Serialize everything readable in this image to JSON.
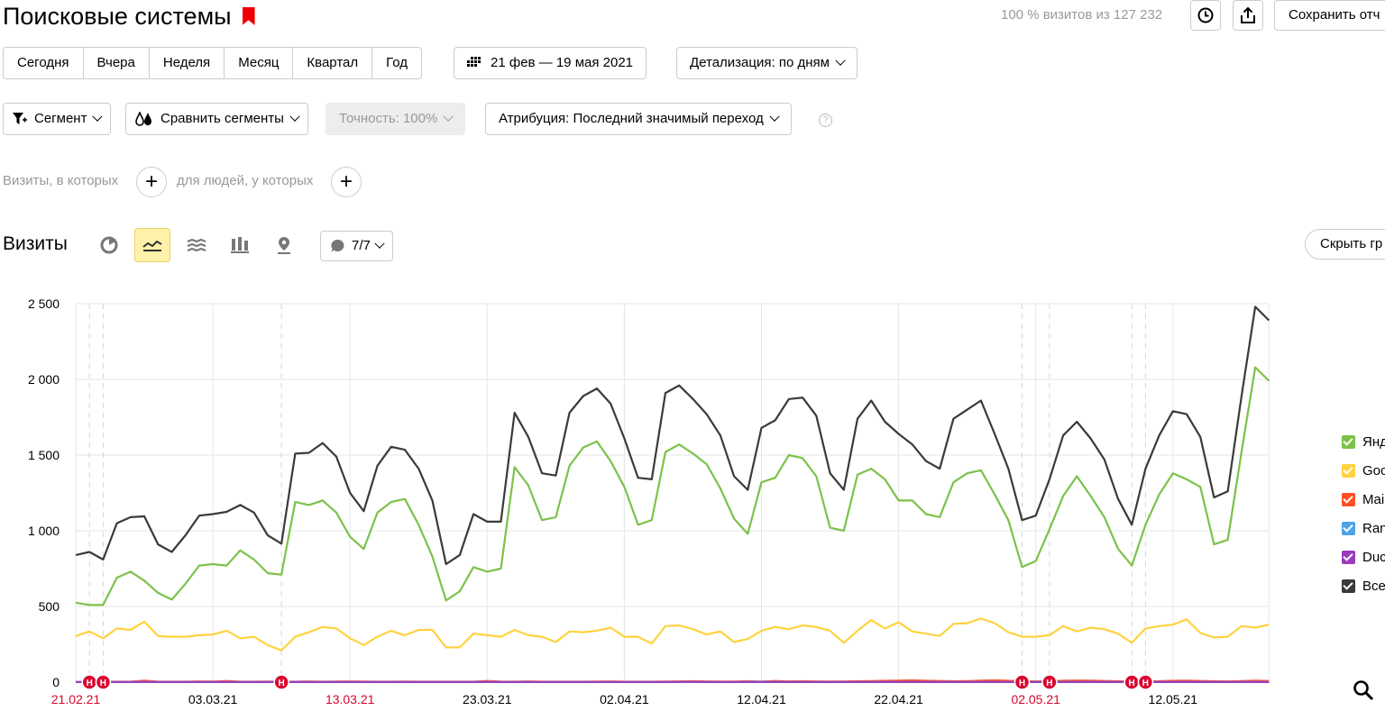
{
  "header": {
    "title": "Поисковые системы",
    "visits_summary": "100 % визитов из 127 232",
    "save_label": "Сохранить отч"
  },
  "periods": [
    "Сегодня",
    "Вчера",
    "Неделя",
    "Месяц",
    "Квартал",
    "Год"
  ],
  "date_range": "21 фев — 19 мая 2021",
  "detail": "Детализация: по дням",
  "toolbar": {
    "segment": "Сегмент",
    "compare": "Сравнить сегменты",
    "accuracy": "Точность: 100%",
    "attribution": "Атрибуция: Последний значимый переход",
    "help": "?"
  },
  "filters": {
    "visits_label": "Визиты, в которых",
    "people_label": "для людей, у которых",
    "plus": "+"
  },
  "section": {
    "title": "Визиты",
    "notes": "7/7",
    "hide_label": "Скрыть гр"
  },
  "icons": [
    "pie-chart-icon",
    "line-chart-icon",
    "area-chart-icon",
    "bar-chart-icon",
    "map-icon",
    "comment-icon",
    "clock-icon",
    "share-icon",
    "calendar-icon",
    "filter-icon",
    "compare-icon",
    "search-icon"
  ],
  "colors": {
    "yandex": "#7cc24a",
    "google": "#ffd23f",
    "mail": "#ff4f24",
    "rambler": "#4ea4e8",
    "duckduckgo": "#9b3bbd",
    "total": "#3a3a3a",
    "holiday": "#d9062f",
    "active_bg": "#fff2a8"
  },
  "chart_data": {
    "type": "line",
    "ylim": [
      0,
      2500
    ],
    "yticks": [
      "2 500",
      "2 000",
      "1 500",
      "1 000",
      "500",
      "0"
    ],
    "ytick_values": [
      2500,
      2000,
      1500,
      1000,
      500,
      0
    ],
    "x_start": "21.02.21",
    "days": 88,
    "xtick_labels": [
      {
        "day": 0,
        "label": "21.02.21",
        "holiday": true
      },
      {
        "day": 10,
        "label": "03.03.21",
        "holiday": false
      },
      {
        "day": 20,
        "label": "13.03.21",
        "holiday": true
      },
      {
        "day": 30,
        "label": "23.03.21",
        "holiday": false
      },
      {
        "day": 40,
        "label": "02.04.21",
        "holiday": false
      },
      {
        "day": 50,
        "label": "12.04.21",
        "holiday": false
      },
      {
        "day": 60,
        "label": "22.04.21",
        "holiday": false
      },
      {
        "day": 70,
        "label": "02.05.21",
        "holiday": true
      },
      {
        "day": 80,
        "label": "12.05.21",
        "holiday": false
      }
    ],
    "holiday_markers": [
      {
        "day": 1,
        "label": "Н"
      },
      {
        "day": 2,
        "label": "Н"
      },
      {
        "day": 15,
        "label": "Н"
      },
      {
        "day": 69,
        "label": "Н"
      },
      {
        "day": 71,
        "label": "Н"
      },
      {
        "day": 77,
        "label": "Н"
      },
      {
        "day": 78,
        "label": "Н"
      }
    ],
    "series": [
      {
        "name": "Яндекс",
        "legend_label": "Янд",
        "color": "#7cc24a",
        "values": [
          525,
          510,
          510,
          690,
          730,
          670,
          590,
          545,
          650,
          770,
          780,
          770,
          870,
          810,
          720,
          710,
          1190,
          1170,
          1200,
          1120,
          960,
          880,
          1120,
          1190,
          1210,
          1040,
          830,
          540,
          600,
          760,
          730,
          750,
          1420,
          1300,
          1070,
          1090,
          1430,
          1550,
          1590,
          1460,
          1290,
          1040,
          1070,
          1520,
          1570,
          1510,
          1440,
          1280,
          1080,
          980,
          1320,
          1350,
          1500,
          1480,
          1360,
          1020,
          1000,
          1370,
          1410,
          1340,
          1200,
          1200,
          1110,
          1090,
          1320,
          1380,
          1400,
          1240,
          1070,
          760,
          800,
          1010,
          1230,
          1360,
          1230,
          1090,
          880,
          770,
          1040,
          1240,
          1380,
          1340,
          1290,
          910,
          940,
          1520,
          2080,
          1990
        ]
      },
      {
        "name": "Google",
        "legend_label": "Goo",
        "color": "#ffd23f",
        "values": [
          305,
          335,
          290,
          355,
          345,
          400,
          305,
          300,
          300,
          310,
          315,
          340,
          290,
          300,
          245,
          210,
          300,
          330,
          365,
          355,
          290,
          245,
          300,
          340,
          310,
          345,
          345,
          230,
          230,
          320,
          310,
          300,
          345,
          310,
          300,
          265,
          335,
          330,
          340,
          360,
          300,
          300,
          255,
          370,
          375,
          350,
          315,
          335,
          265,
          285,
          340,
          365,
          350,
          375,
          365,
          340,
          260,
          340,
          410,
          355,
          395,
          335,
          320,
          305,
          385,
          390,
          420,
          390,
          330,
          300,
          300,
          310,
          370,
          335,
          360,
          350,
          320,
          260,
          355,
          370,
          380,
          415,
          325,
          295,
          300,
          370,
          360,
          380
        ]
      },
      {
        "name": "Mail.ru",
        "legend_label": "Mai",
        "color": "#ff4f24",
        "values": [
          2,
          3,
          4,
          3,
          3,
          10,
          3,
          3,
          3,
          5,
          4,
          8,
          3,
          3,
          4,
          4,
          3,
          5,
          3,
          4,
          5,
          4,
          3,
          3,
          4,
          3,
          3,
          3,
          3,
          3,
          8,
          4,
          3,
          5,
          3,
          3,
          3,
          3,
          4,
          5,
          3,
          3,
          3,
          4,
          5,
          6,
          5,
          4,
          4,
          6,
          4,
          8,
          5,
          6,
          5,
          4,
          5,
          6,
          7,
          9,
          10,
          12,
          9,
          8,
          6,
          7,
          10,
          12,
          9,
          6,
          5,
          7,
          9,
          11,
          10,
          8,
          6,
          5,
          4,
          6,
          9,
          10,
          8,
          6,
          5,
          7,
          10,
          8
        ]
      },
      {
        "name": "Rambler",
        "legend_label": "Ran",
        "color": "#4ea4e8",
        "values": [
          1,
          1,
          1,
          1,
          1,
          2,
          1,
          1,
          1,
          2,
          1,
          1,
          1,
          1,
          1,
          1,
          1,
          2,
          1,
          1,
          1,
          1,
          1,
          1,
          1,
          1,
          1,
          1,
          1,
          1,
          2,
          1,
          1,
          1,
          1,
          1,
          1,
          1,
          1,
          1,
          1,
          1,
          1,
          1,
          1,
          1,
          1,
          1,
          1,
          2,
          3,
          2,
          1,
          1,
          1,
          1,
          1,
          1,
          1,
          1,
          1,
          1,
          1,
          1,
          1,
          1,
          1,
          1,
          1,
          1,
          1,
          1,
          1,
          1,
          1,
          1,
          1,
          1,
          1,
          1,
          1,
          1,
          1,
          1,
          1,
          1,
          2,
          1
        ]
      },
      {
        "name": "DuckDuckGo",
        "legend_label": "Duc",
        "color": "#9b3bbd",
        "values": [
          1,
          1,
          1,
          1,
          1,
          1,
          1,
          1,
          1,
          1,
          1,
          1,
          1,
          1,
          1,
          1,
          1,
          1,
          1,
          1,
          1,
          1,
          1,
          1,
          1,
          1,
          1,
          1,
          1,
          1,
          1,
          1,
          1,
          1,
          1,
          1,
          1,
          1,
          1,
          1,
          1,
          1,
          1,
          1,
          2,
          2,
          1,
          1,
          1,
          1,
          1,
          1,
          1,
          1,
          1,
          1,
          1,
          1,
          1,
          1,
          1,
          1,
          1,
          1,
          1,
          1,
          1,
          1,
          1,
          1,
          1,
          1,
          1,
          1,
          1,
          1,
          1,
          1,
          1,
          1,
          1,
          1,
          1,
          1,
          1,
          1,
          1,
          1
        ]
      },
      {
        "name": "Все",
        "legend_label": "Все",
        "color": "#3a3a3a",
        "values": [
          840,
          860,
          810,
          1050,
          1090,
          1095,
          910,
          860,
          970,
          1100,
          1110,
          1125,
          1170,
          1120,
          970,
          915,
          1510,
          1515,
          1580,
          1490,
          1250,
          1130,
          1430,
          1555,
          1535,
          1410,
          1200,
          780,
          840,
          1110,
          1060,
          1060,
          1780,
          1620,
          1380,
          1365,
          1780,
          1890,
          1940,
          1840,
          1610,
          1350,
          1340,
          1910,
          1960,
          1870,
          1770,
          1630,
          1360,
          1270,
          1680,
          1730,
          1870,
          1880,
          1760,
          1380,
          1270,
          1740,
          1860,
          1720,
          1640,
          1570,
          1460,
          1410,
          1740,
          1800,
          1860,
          1640,
          1410,
          1070,
          1100,
          1340,
          1630,
          1720,
          1610,
          1470,
          1210,
          1040,
          1410,
          1630,
          1790,
          1770,
          1620,
          1220,
          1260,
          1890,
          2480,
          2390
        ]
      }
    ]
  }
}
